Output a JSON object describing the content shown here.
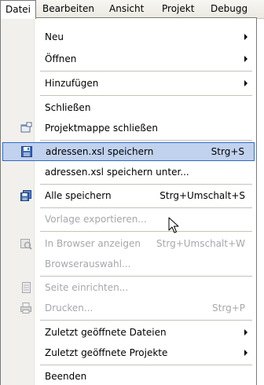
{
  "menubar": {
    "items": [
      {
        "label": "Datei"
      },
      {
        "label": "Bearbeiten"
      },
      {
        "label": "Ansicht"
      },
      {
        "label": "Projekt"
      },
      {
        "label": "Debugg"
      }
    ]
  },
  "menu": {
    "new": {
      "label": "Neu"
    },
    "open": {
      "label": "Öffnen"
    },
    "add": {
      "label": "Hinzufügen"
    },
    "close": {
      "label": "Schließen"
    },
    "close_solution": {
      "label": "Projektmappe schließen",
      "icon": "close-solution-icon"
    },
    "save": {
      "label": "adressen.xsl speichern",
      "shortcut": "Strg+S",
      "icon": "save-icon"
    },
    "save_as": {
      "label": "adressen.xsl speichern unter..."
    },
    "save_all": {
      "label": "Alle speichern",
      "shortcut": "Strg+Umschalt+S",
      "icon": "save-all-icon"
    },
    "export_template": {
      "label": "Vorlage exportieren..."
    },
    "view_in_browser": {
      "label": "In Browser anzeigen",
      "shortcut": "Strg+Umschalt+W",
      "icon": "browser-icon"
    },
    "browse_with": {
      "label": "Browserauswahl..."
    },
    "page_setup": {
      "label": "Seite einrichten...",
      "icon": "page-setup-icon"
    },
    "print": {
      "label": "Drucken...",
      "shortcut": "Strg+P",
      "icon": "printer-icon"
    },
    "recent_files": {
      "label": "Zuletzt geöffnete Dateien"
    },
    "recent_projects": {
      "label": "Zuletzt geöffnete Projekte"
    },
    "exit": {
      "label": "Beenden"
    }
  },
  "colors": {
    "highlight_bg": "#c1d2ee",
    "highlight_border": "#316ac5",
    "disabled_text": "#a7a6aa"
  }
}
